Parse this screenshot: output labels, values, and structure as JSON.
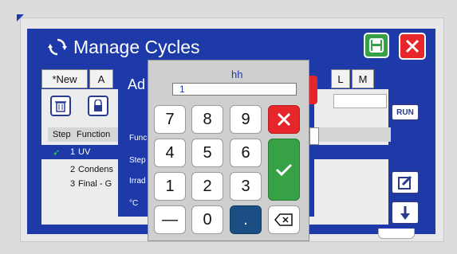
{
  "window": {
    "title": "Manage Cycles"
  },
  "tabs": {
    "new_label": "*New",
    "a_label": "A",
    "l_label": "L",
    "m_label": "M"
  },
  "table": {
    "header": {
      "step": "Step",
      "function": "Function"
    },
    "rows": [
      {
        "step": "1",
        "function": "UV",
        "selected": true
      },
      {
        "step": "2",
        "function": "Condens"
      },
      {
        "step": "3",
        "function": "Final - G"
      }
    ]
  },
  "side_buttons": {
    "run_label": "RUN"
  },
  "dialog": {
    "title": "Ad",
    "labels": [
      "Func",
      "Step",
      "Irrad",
      "°C"
    ]
  },
  "keypad": {
    "label": "hh",
    "value": "1",
    "keys": [
      "7",
      "8",
      "9",
      "4",
      "5",
      "6",
      "1",
      "2",
      "3",
      "—",
      "0",
      "."
    ]
  },
  "colors": {
    "primary": "#1d3aa8",
    "danger": "#e6262a",
    "success": "#37a146",
    "dot_key": "#1b4f83"
  }
}
